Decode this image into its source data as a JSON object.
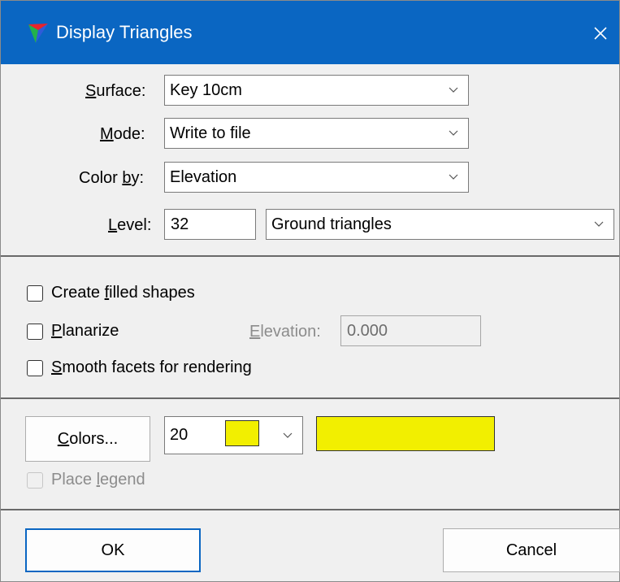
{
  "window": {
    "title": "Display Triangles",
    "close_icon": "close-icon"
  },
  "colors": {
    "titlebar": "#0a66c2",
    "swatch": "#f2ef00"
  },
  "surface": {
    "label_prefix": "",
    "label_key": "S",
    "label_rest": "urface:",
    "value": "Key 10cm"
  },
  "mode": {
    "label_key": "M",
    "label_rest": "ode:",
    "value": "Write to file"
  },
  "color_by": {
    "label_pre": "Color ",
    "label_key": "b",
    "label_rest": "y:",
    "value": "Elevation"
  },
  "level": {
    "label_key": "L",
    "label_rest": "evel:",
    "value": "32",
    "type_value": "Ground triangles"
  },
  "options": {
    "filled": {
      "pre": "Create ",
      "key": "f",
      "rest": "illed shapes",
      "checked": false
    },
    "planarize": {
      "pre": "",
      "key": "P",
      "rest": "lanarize",
      "checked": false
    },
    "elevation": {
      "key": "E",
      "rest": "levation:",
      "value": "0.000"
    },
    "smooth": {
      "pre": "",
      "key": "S",
      "rest": "mooth facets for rendering",
      "checked": false
    }
  },
  "colors_section": {
    "button_key": "C",
    "button_rest": "olors...",
    "count_value": "20",
    "legend": {
      "pre": "Place ",
      "key": "l",
      "rest": "egend",
      "checked": false
    }
  },
  "buttons": {
    "ok": "OK",
    "cancel": "Cancel"
  }
}
